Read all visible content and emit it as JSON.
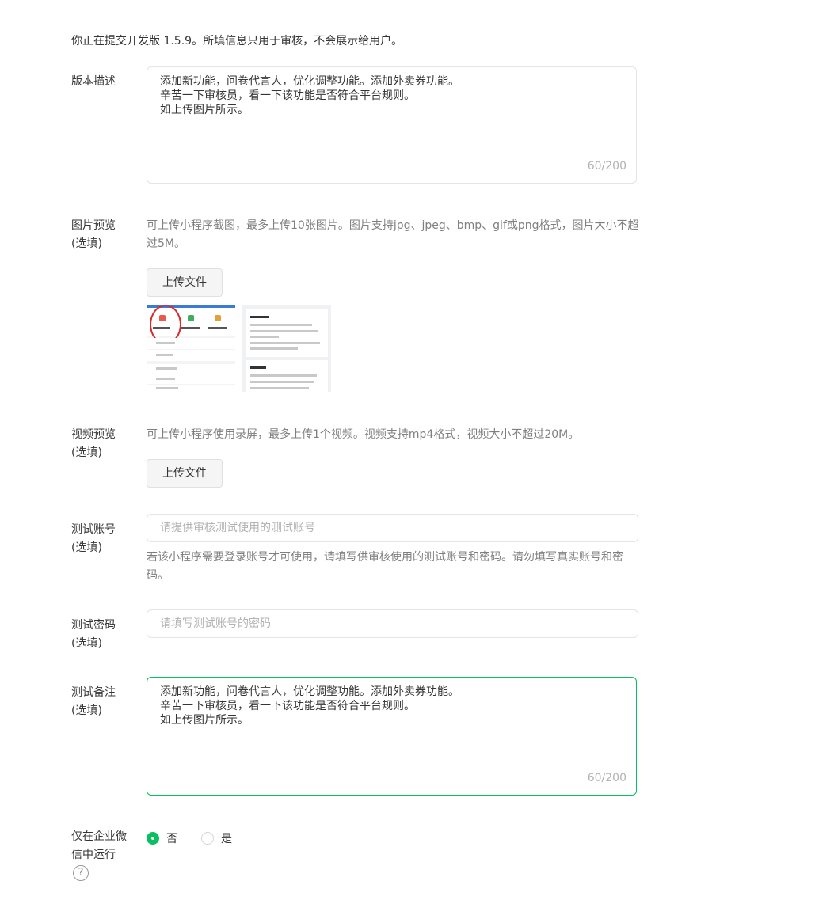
{
  "notice": "你正在提交开发版 1.5.9。所填信息只用于审核，不会展示给用户。",
  "version_desc": {
    "label": "版本描述",
    "lines": [
      "添加新功能，问卷代言人，优化调整功能。添加外卖券功能。",
      "辛苦一下审核员，看一下该功能是否符合平台规则。",
      "如上传图片所示。"
    ],
    "counter": "60/200"
  },
  "image_preview": {
    "label": "图片预览",
    "optional": "(选填)",
    "hint": "可上传小程序截图，最多上传10张图片。图片支持jpg、jpeg、bmp、gif或png格式，图片大小不超过5M。",
    "upload_label": "上传文件"
  },
  "video_preview": {
    "label": "视频预览",
    "optional": "(选填)",
    "hint": "可上传小程序使用录屏，最多上传1个视频。视频支持mp4格式，视频大小不超过20M。",
    "upload_label": "上传文件"
  },
  "test_account": {
    "label": "测试账号",
    "optional": "(选填)",
    "placeholder": "请提供审核测试使用的测试账号",
    "hint": "若该小程序需要登录账号才可使用，请填写供审核使用的测试账号和密码。请勿填写真实账号和密码。"
  },
  "test_password": {
    "label": "测试密码",
    "optional": "(选填)",
    "placeholder": "请填写测试账号的密码"
  },
  "test_notes": {
    "label": "测试备注",
    "optional": "(选填)",
    "lines": [
      "添加新功能，问卷代言人，优化调整功能。添加外卖券功能。",
      "辛苦一下审核员，看一下该功能是否符合平台规则。",
      "如上传图片所示。"
    ],
    "counter": "60/200"
  },
  "wecom_only": {
    "label_line1": "仅在企业微",
    "label_line2": "信中运行",
    "options": [
      {
        "label": "否",
        "selected": true
      },
      {
        "label": "是",
        "selected": false
      }
    ]
  },
  "colors": {
    "accent": "#07c160",
    "hint_text": "#7f7f7f",
    "placeholder": "#b2b2b2"
  },
  "icons": {
    "help": "question-circle-icon"
  }
}
